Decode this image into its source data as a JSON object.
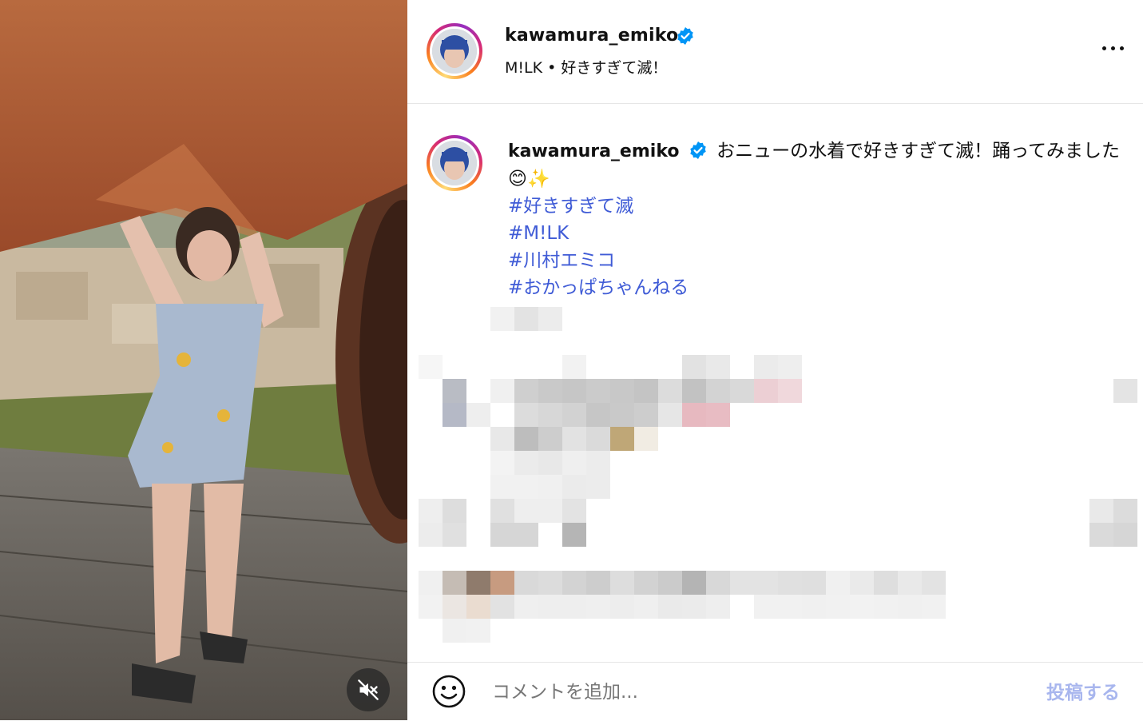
{
  "post": {
    "username": "kawamura_emiko",
    "audio": "M!LK • 好きすぎて滅！",
    "caption_text": "おニューの水着で好きすぎて滅！踊ってみました😊✨",
    "hashtags": [
      "#好きすぎて滅",
      "#M!LK",
      "#川村エミコ",
      "#おかっぱちゃんねる"
    ]
  },
  "comment": {
    "placeholder": "コメントを追加...",
    "post_label": "投稿する"
  },
  "icons": {
    "verified": "verified-badge-icon",
    "more": "more-options-icon",
    "mute": "muted-speaker-icon",
    "emoji": "emoji-smiley-icon"
  },
  "colors": {
    "hashtag": "#3f5bd6",
    "verified": "#0095f6",
    "post_button_disabled": "#a8b6ee"
  }
}
